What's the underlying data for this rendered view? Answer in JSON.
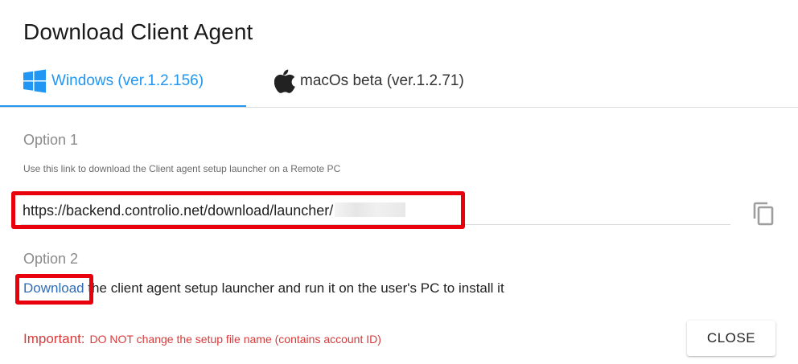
{
  "dialog": {
    "title": "Download Client Agent"
  },
  "tabs": [
    {
      "label": "Windows (ver.1.2.156)",
      "icon": "windows-logo-icon",
      "active": true,
      "color": "#2196f3"
    },
    {
      "label": "macOs beta (ver.1.2.71)",
      "icon": "apple-logo-icon",
      "active": false
    }
  ],
  "option1": {
    "label": "Option 1",
    "hint": "Use this link to download the Client agent setup launcher on a Remote PC",
    "url": "https://backend.controlio.net/download/launcher/",
    "copy_icon": "copy-icon"
  },
  "option2": {
    "label": "Option 2",
    "link_text": "Download",
    "text": " the client agent setup launcher and run it on the user's PC to install it"
  },
  "footer": {
    "important_label": "Important:",
    "important_text": "DO NOT change the setup file name (contains account ID)",
    "close_label": "CLOSE"
  },
  "colors": {
    "accent": "#2196f3",
    "highlight": "#e8000b",
    "warning": "#d83a3a",
    "link": "#2f6db5"
  }
}
